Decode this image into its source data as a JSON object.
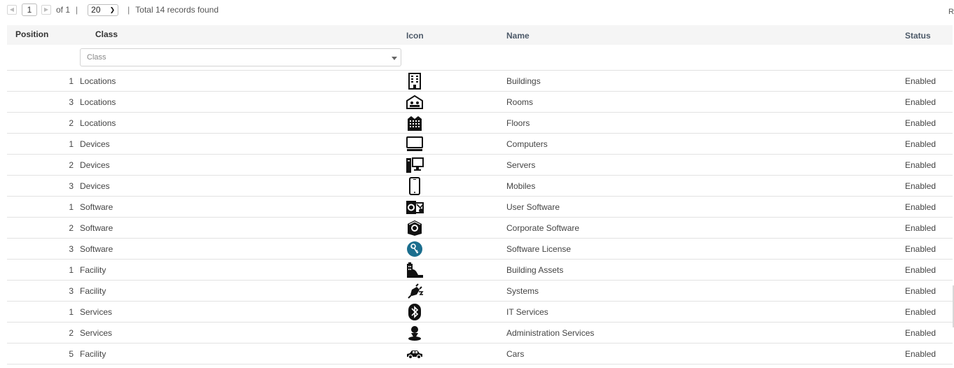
{
  "pager": {
    "prev_icon": "chevron-left-icon",
    "next_icon": "chevron-right-icon",
    "page": "1",
    "of_label": "of 1",
    "sep": "|",
    "page_size": "20",
    "total": "Total 14 records found"
  },
  "corner_text": "R",
  "columns": {
    "position": "Position",
    "class": "Class",
    "icon": "Icon",
    "name": "Name",
    "status": "Status"
  },
  "filter": {
    "placeholder": "Class"
  },
  "accent": "#1b6e8e",
  "rows": [
    {
      "position": "1",
      "class": "Locations",
      "icon": "building-icon",
      "name": "Buildings",
      "status": "Enabled"
    },
    {
      "position": "3",
      "class": "Locations",
      "icon": "room-icon",
      "name": "Rooms",
      "status": "Enabled"
    },
    {
      "position": "2",
      "class": "Locations",
      "icon": "floors-icon",
      "name": "Floors",
      "status": "Enabled"
    },
    {
      "position": "1",
      "class": "Devices",
      "icon": "computer-icon",
      "name": "Computers",
      "status": "Enabled"
    },
    {
      "position": "2",
      "class": "Devices",
      "icon": "server-icon",
      "name": "Servers",
      "status": "Enabled"
    },
    {
      "position": "3",
      "class": "Devices",
      "icon": "mobile-icon",
      "name": "Mobiles",
      "status": "Enabled"
    },
    {
      "position": "1",
      "class": "Software",
      "icon": "user-software-icon",
      "name": "User Software",
      "status": "Enabled"
    },
    {
      "position": "2",
      "class": "Software",
      "icon": "corporate-software-icon",
      "name": "Corporate Software",
      "status": "Enabled"
    },
    {
      "position": "3",
      "class": "Software",
      "icon": "license-key-icon",
      "name": "Software License",
      "status": "Enabled"
    },
    {
      "position": "1",
      "class": "Facility",
      "icon": "building-assets-icon",
      "name": "Building Assets",
      "status": "Enabled"
    },
    {
      "position": "3",
      "class": "Facility",
      "icon": "plug-icon",
      "name": "Systems",
      "status": "Enabled"
    },
    {
      "position": "1",
      "class": "Services",
      "icon": "bluetooth-icon",
      "name": "IT Services",
      "status": "Enabled"
    },
    {
      "position": "2",
      "class": "Services",
      "icon": "person-pin-icon",
      "name": "Administration Services",
      "status": "Enabled"
    },
    {
      "position": "5",
      "class": "Facility",
      "icon": "car-icon",
      "name": "Cars",
      "status": "Enabled"
    }
  ]
}
